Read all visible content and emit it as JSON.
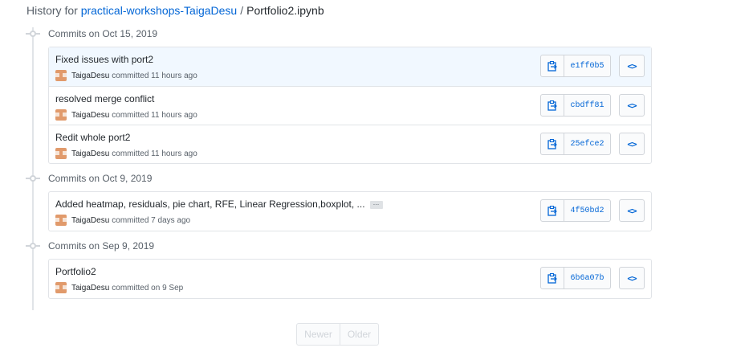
{
  "breadcrumb": {
    "prefix": "History for",
    "repo": "practical-workshops-TaigaDesu",
    "separator": "/",
    "file": "Portfolio2.ipynb"
  },
  "groups": [
    {
      "title": "Commits on Oct 15, 2019",
      "commits": [
        {
          "title": "Fixed issues with port2",
          "author": "TaigaDesu",
          "when": "committed 11 hours ago",
          "sha": "e1ff0b5"
        },
        {
          "title": "resolved merge conflict",
          "author": "TaigaDesu",
          "when": "committed 11 hours ago",
          "sha": "cbdff81"
        },
        {
          "title": "Redit whole port2",
          "author": "TaigaDesu",
          "when": "committed 11 hours ago",
          "sha": "25efce2"
        }
      ]
    },
    {
      "title": "Commits on Oct 9, 2019",
      "commits": [
        {
          "title": "Added heatmap, residuals, pie chart, RFE, Linear Regression,boxplot, ...",
          "ellipsis": "…",
          "author": "TaigaDesu",
          "when": "committed 7 days ago",
          "sha": "4f50bd2"
        }
      ]
    },
    {
      "title": "Commits on Sep 9, 2019",
      "commits": [
        {
          "title": "Portfolio2",
          "author": "TaigaDesu",
          "when": "committed on 9 Sep",
          "sha": "6b6a07b"
        }
      ]
    }
  ],
  "icons": {
    "copy": "clippy-icon",
    "browse": "code-icon",
    "browse_glyph": "<>",
    "group": "git-commit-icon"
  },
  "pagination": {
    "newer": "Newer",
    "older": "Older"
  },
  "colors": {
    "link": "#0366d6",
    "highlight_row": "#f1f8ff",
    "avatar": "#e19a6b"
  }
}
